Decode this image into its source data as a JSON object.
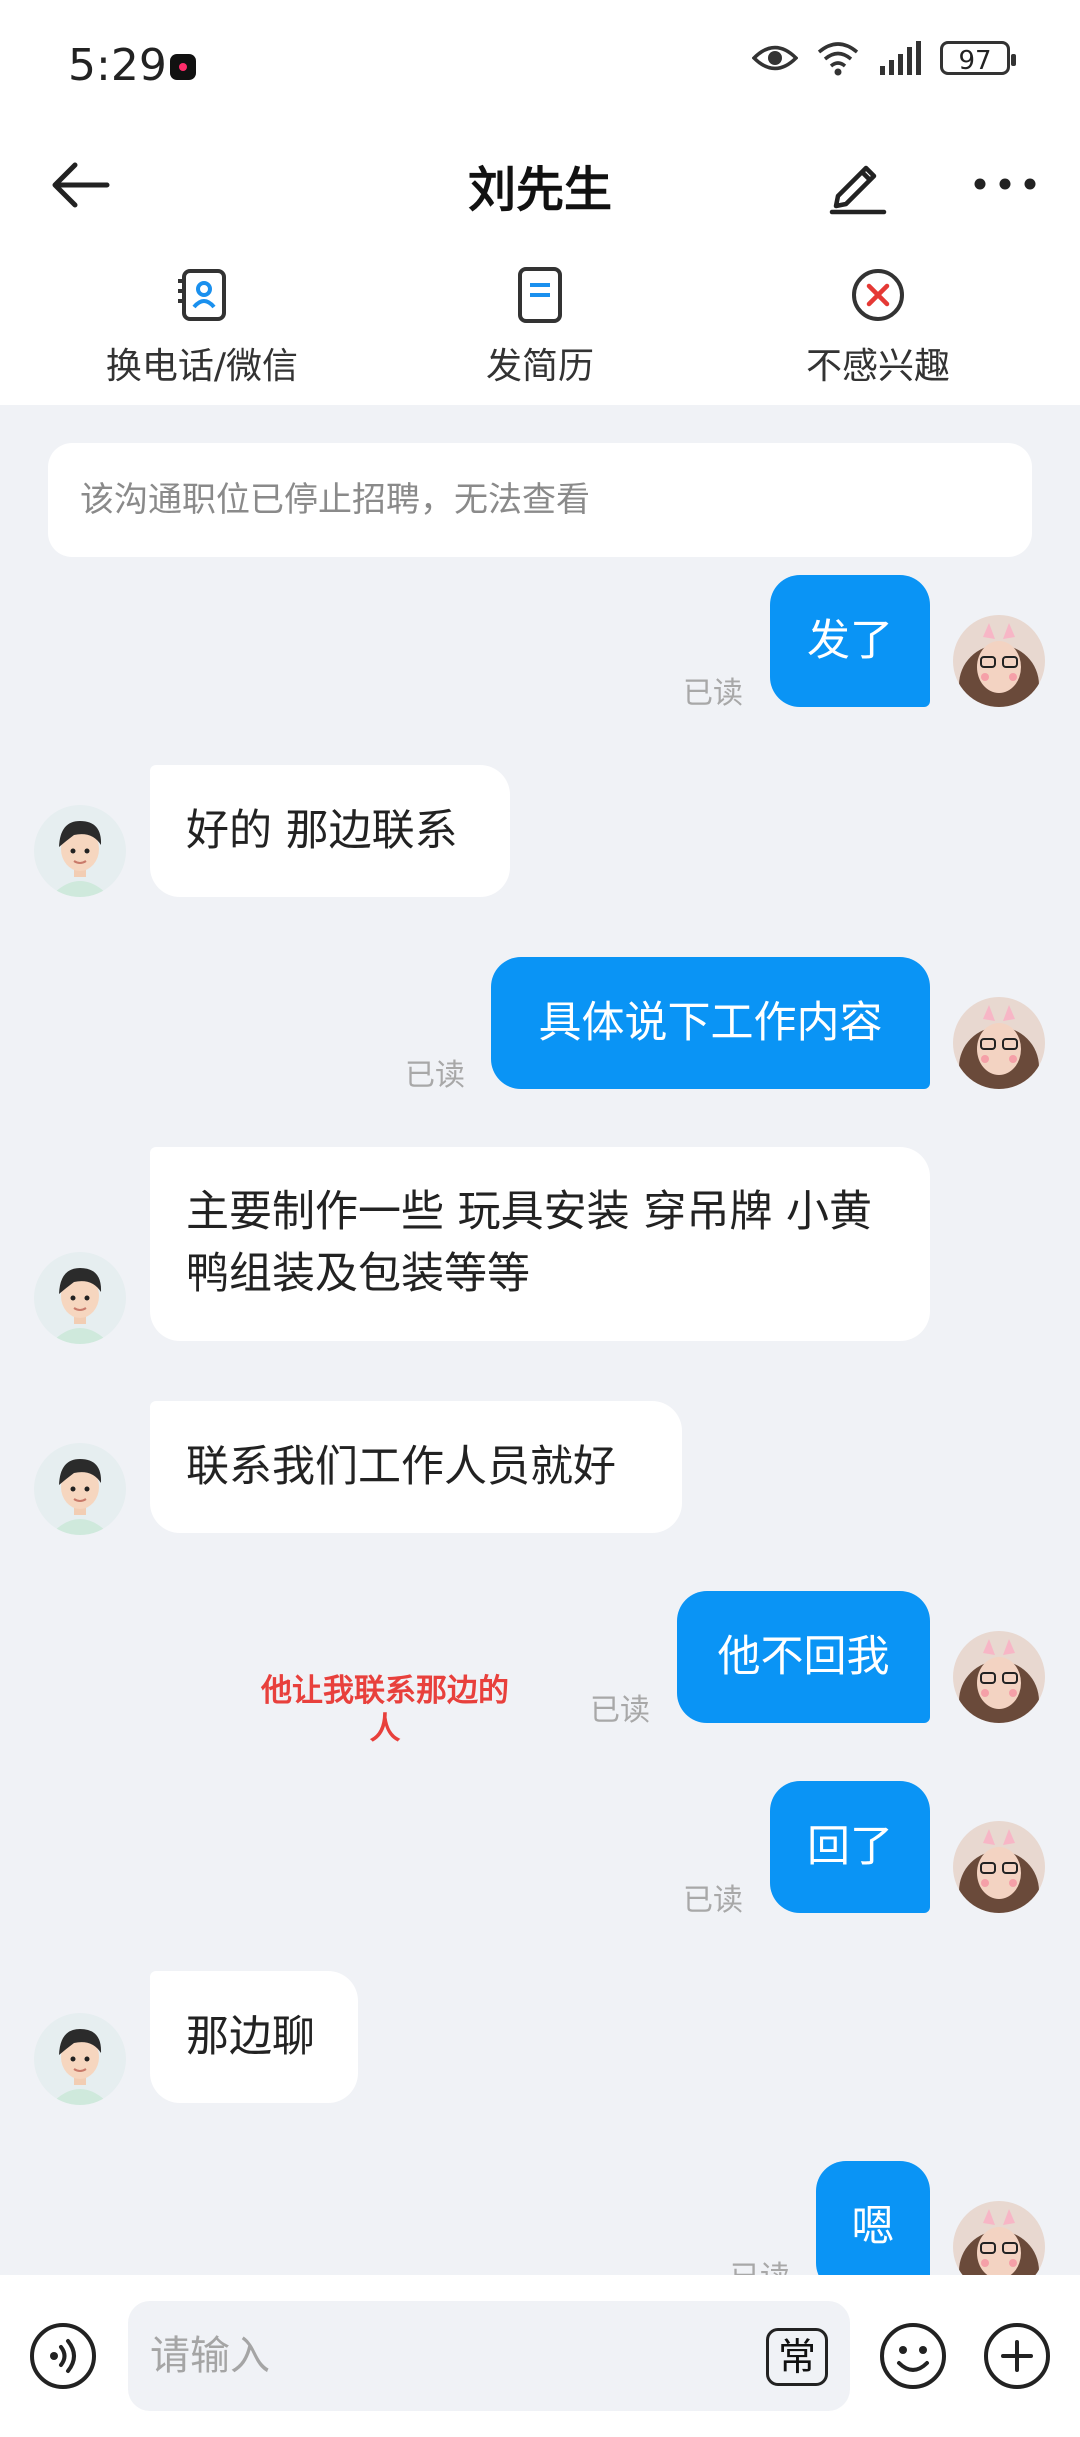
{
  "status_bar": {
    "time": "5:29",
    "battery": "97"
  },
  "header": {
    "title": "刘先生"
  },
  "actions": [
    {
      "label": "换电话/微信"
    },
    {
      "label": "发简历"
    },
    {
      "label": "不感兴趣"
    }
  ],
  "notice": "该沟通职位已停止招聘，无法查看",
  "messages": [
    {
      "from": "me",
      "text": "发了",
      "status": "已读"
    },
    {
      "from": "them",
      "text": "好的 那边联系"
    },
    {
      "from": "me",
      "text": "具体说下工作内容",
      "status": "已读"
    },
    {
      "from": "them",
      "text": "主要制作一些 玩具安装  穿吊牌 小黄鸭组装及包装等等"
    },
    {
      "from": "them",
      "text": "联系我们工作人员就好"
    },
    {
      "from": "me",
      "text": "他不回我",
      "status": "已读"
    },
    {
      "from": "me",
      "text": "回了",
      "status": "已读"
    },
    {
      "from": "them",
      "text": "那边聊"
    },
    {
      "from": "me",
      "text": "嗯",
      "status": "已读"
    }
  ],
  "annotation": "他让我联系那边的人",
  "composer": {
    "placeholder": "请输入",
    "phrase_label": "常"
  },
  "colors": {
    "accent": "#0a94f5",
    "annotation": "#e8403c"
  }
}
